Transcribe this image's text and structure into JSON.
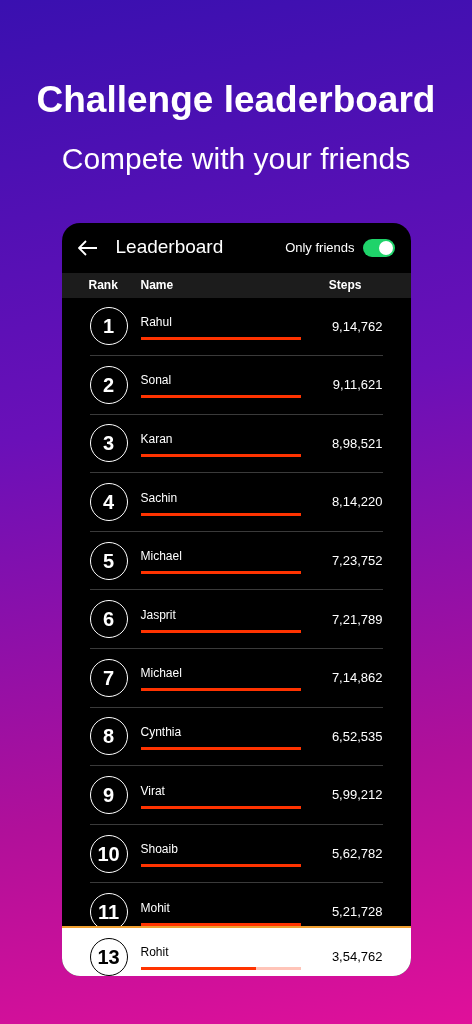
{
  "headline": "Challenge leaderboard",
  "subheadline": "Compete with your friends",
  "screen": {
    "title": "Leaderboard",
    "only_friends": {
      "label": "Only friends",
      "on": true
    },
    "columns": [
      "Rank",
      "Name",
      "Steps"
    ],
    "rows": [
      {
        "rank": "1",
        "name": "Rahul",
        "steps": "9,14,762",
        "level": 1
      },
      {
        "rank": "2",
        "name": "Sonal",
        "steps": "9,11,621",
        "level": 1
      },
      {
        "rank": "3",
        "name": "Karan",
        "steps": "8,98,521",
        "level": 1
      },
      {
        "rank": "4",
        "name": "Sachin",
        "steps": "8,14,220",
        "level": 1
      },
      {
        "rank": "5",
        "name": "Michael",
        "steps": "7,23,752",
        "level": 1
      },
      {
        "rank": "6",
        "name": "Jasprit",
        "steps": "7,21,789",
        "level": 1
      },
      {
        "rank": "7",
        "name": "Michael",
        "steps": "7,14,862",
        "level": 1
      },
      {
        "rank": "8",
        "name": "Cynthia",
        "steps": "6,52,535",
        "level": 1
      },
      {
        "rank": "9",
        "name": "Virat",
        "steps": "5,99,212",
        "level": 1
      },
      {
        "rank": "10",
        "name": "Shoaib",
        "steps": "5,62,782",
        "level": 1
      },
      {
        "rank": "11",
        "name": "Mohit",
        "steps": "5,21,728",
        "level": 1
      }
    ],
    "me": {
      "rank": "13",
      "name": "Rohit",
      "steps": "3,54,762",
      "level": 0.72
    }
  }
}
